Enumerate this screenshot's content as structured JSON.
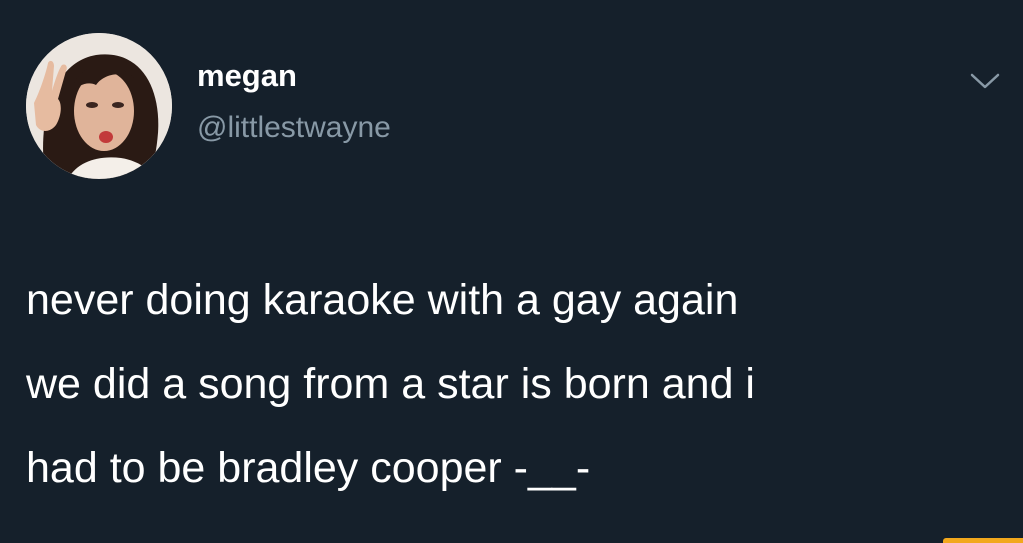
{
  "tweet": {
    "author": {
      "name": "megan",
      "handle": "@littlestwayne",
      "avatar_icon": "profile-photo"
    },
    "menu_icon": "chevron-down-icon",
    "text_lines": [
      "never doing karaoke with a gay again",
      "we did a song from a star is born and i",
      "had to be bradley cooper -__-"
    ]
  },
  "colors": {
    "background": "#15202b",
    "text": "#ffffff",
    "secondary_text": "#8899a6",
    "watermark": "#f2a81d"
  }
}
